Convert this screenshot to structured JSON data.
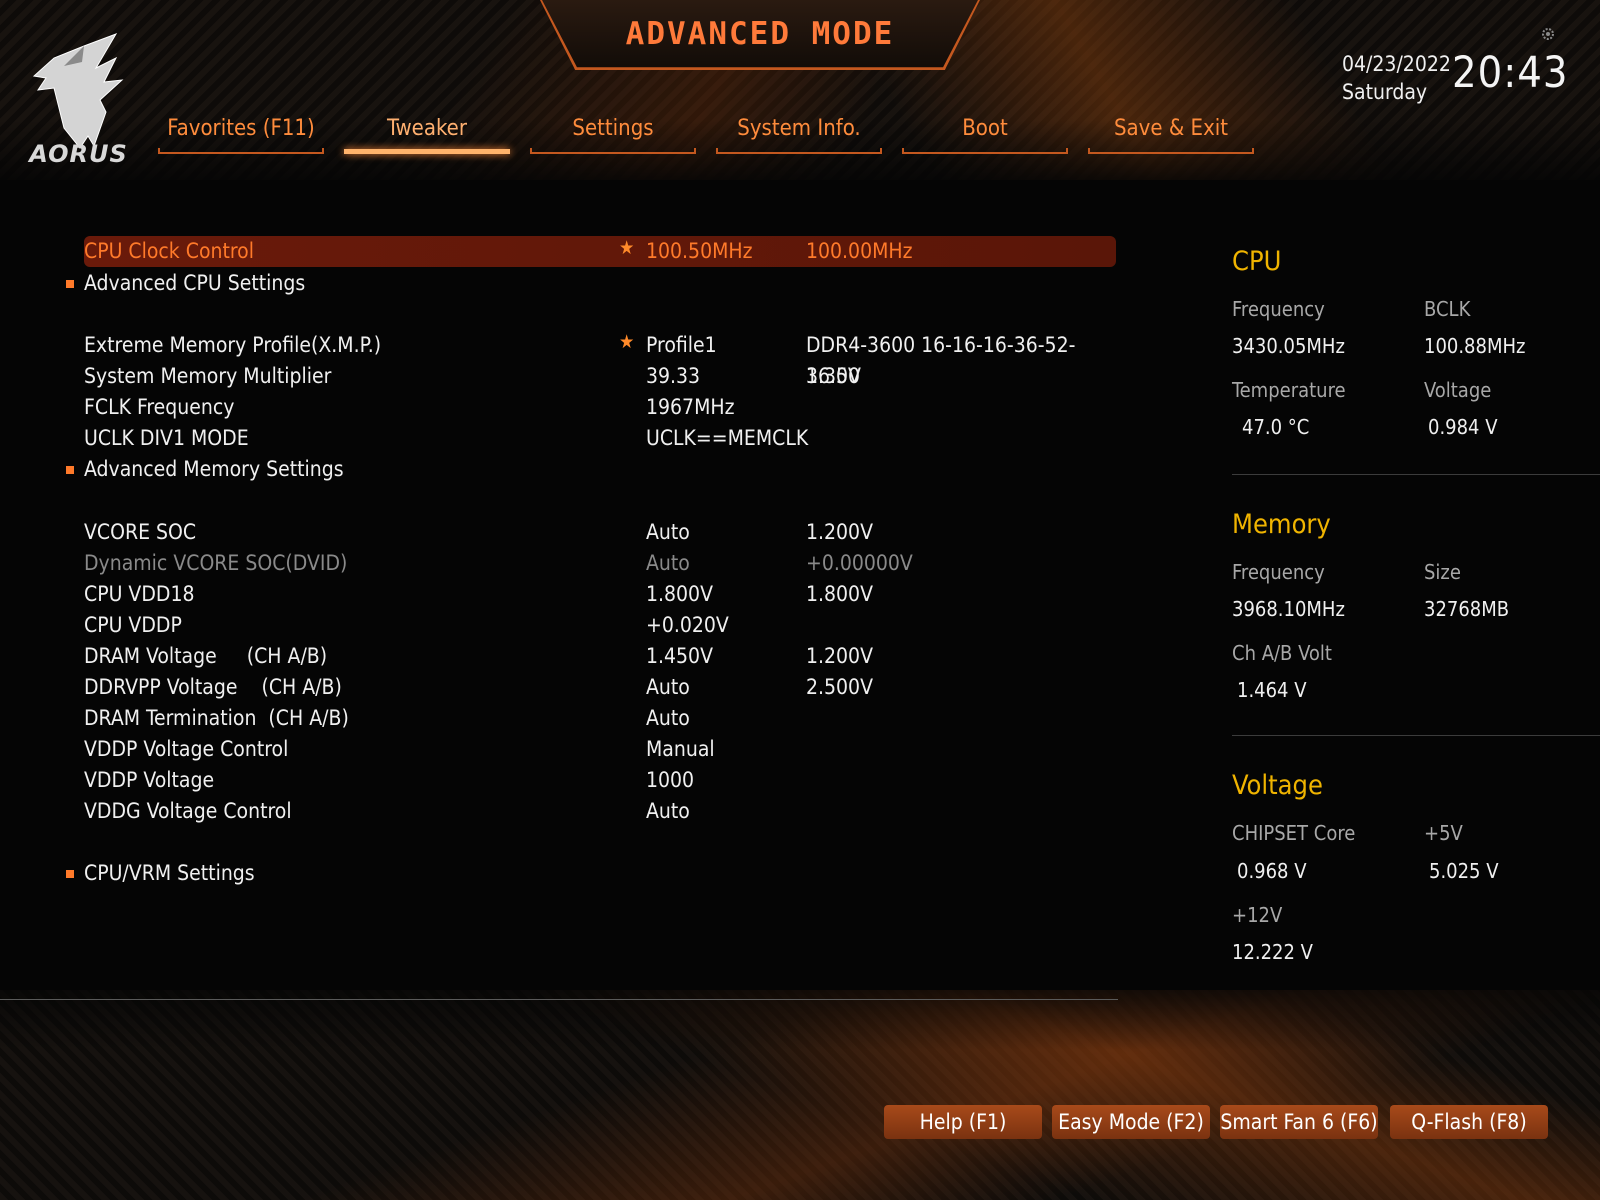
{
  "header": {
    "title": "ADVANCED MODE",
    "logo_text": "AORUS",
    "date": "04/23/2022",
    "weekday": "Saturday",
    "time": "20:43"
  },
  "tabs": [
    {
      "label": "Favorites (F11)",
      "active": false
    },
    {
      "label": "Tweaker",
      "active": true
    },
    {
      "label": "Settings",
      "active": false
    },
    {
      "label": "System Info.",
      "active": false
    },
    {
      "label": "Boot",
      "active": false
    },
    {
      "label": "Save & Exit",
      "active": false
    }
  ],
  "settings": [
    {
      "label": "CPU Clock Control",
      "value": "100.50MHz",
      "current": "100.00MHz",
      "star": true,
      "selected": true
    },
    {
      "label": "Advanced CPU Settings",
      "submenu": true
    },
    {
      "label": "Extreme Memory Profile(X.M.P.)",
      "value": "Profile1",
      "current": "DDR4-3600 16-16-16-36-52-1.35V",
      "star": true
    },
    {
      "label": "System Memory Multiplier",
      "value": "39.33",
      "current": "36.00"
    },
    {
      "label": "FCLK Frequency",
      "value": "1967MHz",
      "current": ""
    },
    {
      "label": "UCLK DIV1 MODE",
      "value": "UCLK==MEMCLK",
      "current": ""
    },
    {
      "label": "Advanced Memory Settings",
      "submenu": true
    },
    {
      "label": "VCORE SOC",
      "value": "Auto",
      "current": "1.200V"
    },
    {
      "label": "Dynamic VCORE SOC(DVID)",
      "value": "Auto",
      "current": "+0.00000V",
      "disabled": true
    },
    {
      "label": "CPU VDD18",
      "value": "1.800V",
      "current": "1.800V"
    },
    {
      "label": "CPU VDDP",
      "value": "+0.020V",
      "current": ""
    },
    {
      "label": "DRAM Voltage     (CH A/B)",
      "value": "1.450V",
      "current": "1.200V"
    },
    {
      "label": "DDRVPP Voltage    (CH A/B)",
      "value": "Auto",
      "current": "2.500V"
    },
    {
      "label": "DRAM Termination  (CH A/B)",
      "value": "Auto",
      "current": ""
    },
    {
      "label": "VDDP Voltage Control",
      "value": "Manual",
      "current": ""
    },
    {
      "label": "VDDP Voltage",
      "value": "1000",
      "current": ""
    },
    {
      "label": "VDDG Voltage Control",
      "value": "Auto",
      "current": ""
    },
    {
      "label": "CPU/VRM Settings",
      "submenu": true
    }
  ],
  "panel": {
    "cpu": {
      "title": "CPU",
      "frequency_label": "Frequency",
      "frequency": "3430.05MHz",
      "bclk_label": "BCLK",
      "bclk": "100.88MHz",
      "temperature_label": "Temperature",
      "temperature": "47.0 °C",
      "voltage_label": "Voltage",
      "voltage": "0.984 V"
    },
    "memory": {
      "title": "Memory",
      "frequency_label": "Frequency",
      "frequency": "3968.10MHz",
      "size_label": "Size",
      "size": "32768MB",
      "chab_label": "Ch A/B Volt",
      "chab": "1.464 V"
    },
    "voltage": {
      "title": "Voltage",
      "chipset_label": "CHIPSET Core",
      "chipset": "0.968 V",
      "p5v_label": "+5V",
      "p5v": "5.025 V",
      "p12v_label": "+12V",
      "p12v": "12.222 V"
    }
  },
  "footer": {
    "help": "Help (F1)",
    "easy": "Easy Mode (F2)",
    "fan": "Smart Fan 6 (F6)",
    "qflash": "Q-Flash (F8)"
  },
  "colors": {
    "accent": "#ff7a2a",
    "panel_title": "#f0b400",
    "selected_row": "#6a1a0a"
  }
}
